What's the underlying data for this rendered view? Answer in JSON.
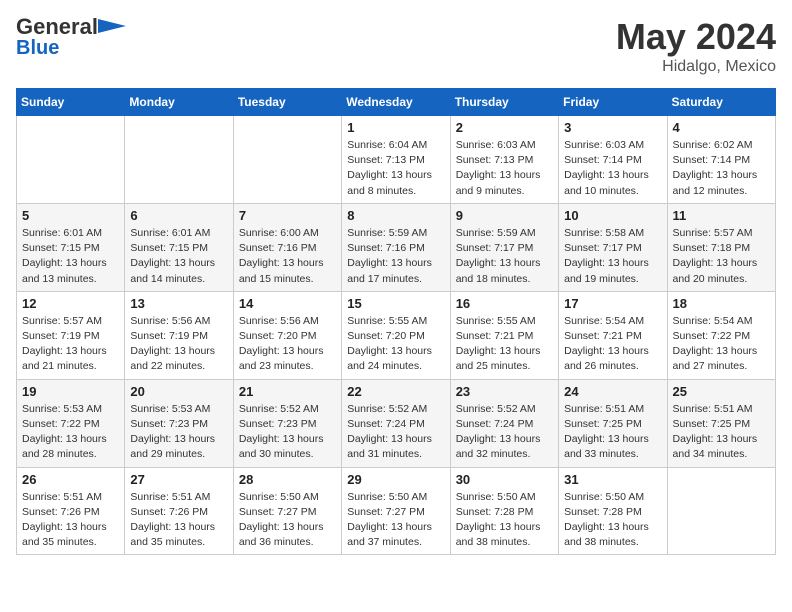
{
  "header": {
    "logo_line1": "General",
    "logo_line2": "Blue",
    "main_title": "May 2024",
    "sub_title": "Hidalgo, Mexico"
  },
  "calendar": {
    "days_of_week": [
      "Sunday",
      "Monday",
      "Tuesday",
      "Wednesday",
      "Thursday",
      "Friday",
      "Saturday"
    ],
    "weeks": [
      [
        {
          "day": "",
          "sunrise": "",
          "sunset": "",
          "daylight": ""
        },
        {
          "day": "",
          "sunrise": "",
          "sunset": "",
          "daylight": ""
        },
        {
          "day": "",
          "sunrise": "",
          "sunset": "",
          "daylight": ""
        },
        {
          "day": "1",
          "sunrise": "Sunrise: 6:04 AM",
          "sunset": "Sunset: 7:13 PM",
          "daylight": "Daylight: 13 hours and 8 minutes."
        },
        {
          "day": "2",
          "sunrise": "Sunrise: 6:03 AM",
          "sunset": "Sunset: 7:13 PM",
          "daylight": "Daylight: 13 hours and 9 minutes."
        },
        {
          "day": "3",
          "sunrise": "Sunrise: 6:03 AM",
          "sunset": "Sunset: 7:14 PM",
          "daylight": "Daylight: 13 hours and 10 minutes."
        },
        {
          "day": "4",
          "sunrise": "Sunrise: 6:02 AM",
          "sunset": "Sunset: 7:14 PM",
          "daylight": "Daylight: 13 hours and 12 minutes."
        }
      ],
      [
        {
          "day": "5",
          "sunrise": "Sunrise: 6:01 AM",
          "sunset": "Sunset: 7:15 PM",
          "daylight": "Daylight: 13 hours and 13 minutes."
        },
        {
          "day": "6",
          "sunrise": "Sunrise: 6:01 AM",
          "sunset": "Sunset: 7:15 PM",
          "daylight": "Daylight: 13 hours and 14 minutes."
        },
        {
          "day": "7",
          "sunrise": "Sunrise: 6:00 AM",
          "sunset": "Sunset: 7:16 PM",
          "daylight": "Daylight: 13 hours and 15 minutes."
        },
        {
          "day": "8",
          "sunrise": "Sunrise: 5:59 AM",
          "sunset": "Sunset: 7:16 PM",
          "daylight": "Daylight: 13 hours and 17 minutes."
        },
        {
          "day": "9",
          "sunrise": "Sunrise: 5:59 AM",
          "sunset": "Sunset: 7:17 PM",
          "daylight": "Daylight: 13 hours and 18 minutes."
        },
        {
          "day": "10",
          "sunrise": "Sunrise: 5:58 AM",
          "sunset": "Sunset: 7:17 PM",
          "daylight": "Daylight: 13 hours and 19 minutes."
        },
        {
          "day": "11",
          "sunrise": "Sunrise: 5:57 AM",
          "sunset": "Sunset: 7:18 PM",
          "daylight": "Daylight: 13 hours and 20 minutes."
        }
      ],
      [
        {
          "day": "12",
          "sunrise": "Sunrise: 5:57 AM",
          "sunset": "Sunset: 7:19 PM",
          "daylight": "Daylight: 13 hours and 21 minutes."
        },
        {
          "day": "13",
          "sunrise": "Sunrise: 5:56 AM",
          "sunset": "Sunset: 7:19 PM",
          "daylight": "Daylight: 13 hours and 22 minutes."
        },
        {
          "day": "14",
          "sunrise": "Sunrise: 5:56 AM",
          "sunset": "Sunset: 7:20 PM",
          "daylight": "Daylight: 13 hours and 23 minutes."
        },
        {
          "day": "15",
          "sunrise": "Sunrise: 5:55 AM",
          "sunset": "Sunset: 7:20 PM",
          "daylight": "Daylight: 13 hours and 24 minutes."
        },
        {
          "day": "16",
          "sunrise": "Sunrise: 5:55 AM",
          "sunset": "Sunset: 7:21 PM",
          "daylight": "Daylight: 13 hours and 25 minutes."
        },
        {
          "day": "17",
          "sunrise": "Sunrise: 5:54 AM",
          "sunset": "Sunset: 7:21 PM",
          "daylight": "Daylight: 13 hours and 26 minutes."
        },
        {
          "day": "18",
          "sunrise": "Sunrise: 5:54 AM",
          "sunset": "Sunset: 7:22 PM",
          "daylight": "Daylight: 13 hours and 27 minutes."
        }
      ],
      [
        {
          "day": "19",
          "sunrise": "Sunrise: 5:53 AM",
          "sunset": "Sunset: 7:22 PM",
          "daylight": "Daylight: 13 hours and 28 minutes."
        },
        {
          "day": "20",
          "sunrise": "Sunrise: 5:53 AM",
          "sunset": "Sunset: 7:23 PM",
          "daylight": "Daylight: 13 hours and 29 minutes."
        },
        {
          "day": "21",
          "sunrise": "Sunrise: 5:52 AM",
          "sunset": "Sunset: 7:23 PM",
          "daylight": "Daylight: 13 hours and 30 minutes."
        },
        {
          "day": "22",
          "sunrise": "Sunrise: 5:52 AM",
          "sunset": "Sunset: 7:24 PM",
          "daylight": "Daylight: 13 hours and 31 minutes."
        },
        {
          "day": "23",
          "sunrise": "Sunrise: 5:52 AM",
          "sunset": "Sunset: 7:24 PM",
          "daylight": "Daylight: 13 hours and 32 minutes."
        },
        {
          "day": "24",
          "sunrise": "Sunrise: 5:51 AM",
          "sunset": "Sunset: 7:25 PM",
          "daylight": "Daylight: 13 hours and 33 minutes."
        },
        {
          "day": "25",
          "sunrise": "Sunrise: 5:51 AM",
          "sunset": "Sunset: 7:25 PM",
          "daylight": "Daylight: 13 hours and 34 minutes."
        }
      ],
      [
        {
          "day": "26",
          "sunrise": "Sunrise: 5:51 AM",
          "sunset": "Sunset: 7:26 PM",
          "daylight": "Daylight: 13 hours and 35 minutes."
        },
        {
          "day": "27",
          "sunrise": "Sunrise: 5:51 AM",
          "sunset": "Sunset: 7:26 PM",
          "daylight": "Daylight: 13 hours and 35 minutes."
        },
        {
          "day": "28",
          "sunrise": "Sunrise: 5:50 AM",
          "sunset": "Sunset: 7:27 PM",
          "daylight": "Daylight: 13 hours and 36 minutes."
        },
        {
          "day": "29",
          "sunrise": "Sunrise: 5:50 AM",
          "sunset": "Sunset: 7:27 PM",
          "daylight": "Daylight: 13 hours and 37 minutes."
        },
        {
          "day": "30",
          "sunrise": "Sunrise: 5:50 AM",
          "sunset": "Sunset: 7:28 PM",
          "daylight": "Daylight: 13 hours and 38 minutes."
        },
        {
          "day": "31",
          "sunrise": "Sunrise: 5:50 AM",
          "sunset": "Sunset: 7:28 PM",
          "daylight": "Daylight: 13 hours and 38 minutes."
        },
        {
          "day": "",
          "sunrise": "",
          "sunset": "",
          "daylight": ""
        }
      ]
    ]
  }
}
